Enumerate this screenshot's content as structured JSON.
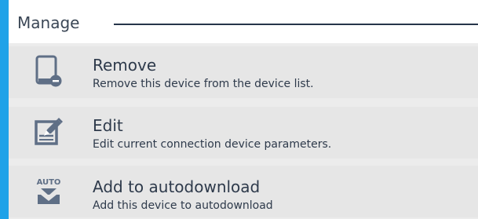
{
  "section": {
    "title": "Manage"
  },
  "actions": [
    {
      "icon": "tablet-remove-icon",
      "label": "Remove",
      "description": "Remove this device from the device list."
    },
    {
      "icon": "edit-icon",
      "label": "Edit",
      "description": "Edit current connection device parameters."
    },
    {
      "icon": "auto-download-icon",
      "label": "Add to autodownload",
      "description": "Add this device to autodownload"
    }
  ],
  "colors": {
    "background_accent": "#1fa2e8",
    "icon": "#5f6f86",
    "text": "#2e3a4b",
    "rule": "#26354a"
  }
}
